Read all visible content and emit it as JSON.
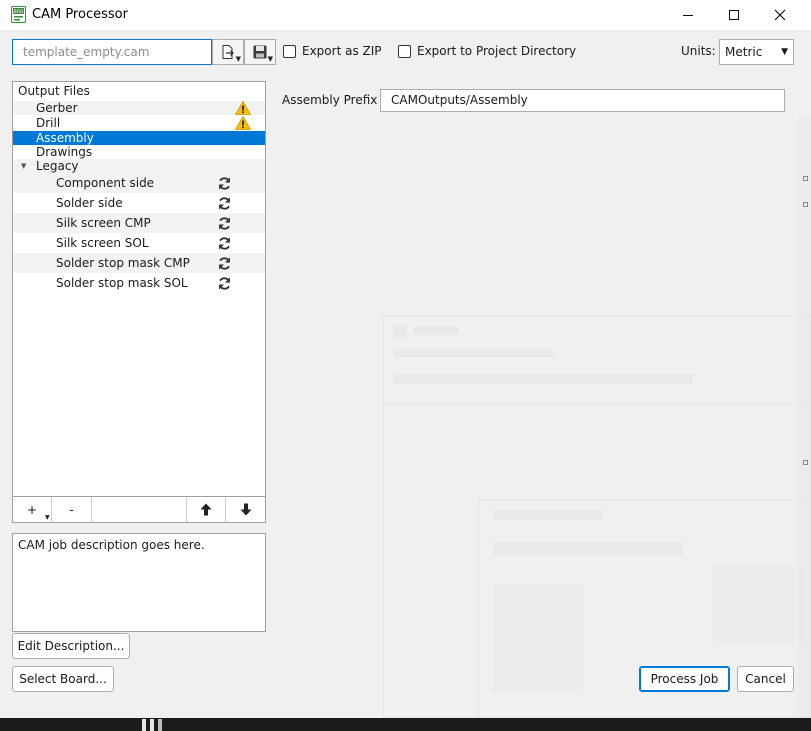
{
  "window": {
    "title": "CAM Processor",
    "app_icon": "eagle-app-icon",
    "controls": [
      "minimize-icon",
      "maximize-icon",
      "close-icon"
    ]
  },
  "toolbar": {
    "file_name": "template_empty.cam",
    "open_icon": "open-file-icon",
    "save_icon": "save-disk-icon",
    "export_zip_label": "Export as ZIP",
    "export_zip_checked": false,
    "export_project_label": "Export to Project Directory",
    "export_project_checked": false,
    "units_label": "Units:",
    "units_value": "Metric"
  },
  "tree": {
    "header": "Output Files",
    "items": [
      {
        "label": "Gerber",
        "icon": "warning-icon",
        "selected": false
      },
      {
        "label": "Drill",
        "icon": "warning-icon",
        "selected": false
      },
      {
        "label": "Assembly",
        "icon": "",
        "selected": true
      },
      {
        "label": "Drawings",
        "icon": "",
        "selected": false
      },
      {
        "label": "Legacy",
        "icon": "",
        "selected": false,
        "expanded": true
      }
    ],
    "legacy_children": [
      {
        "label": "Component side",
        "icon": "refresh-icon"
      },
      {
        "label": "Solder side",
        "icon": "refresh-icon"
      },
      {
        "label": "Silk screen CMP",
        "icon": "refresh-icon"
      },
      {
        "label": "Silk screen SOL",
        "icon": "refresh-icon"
      },
      {
        "label": "Solder stop mask CMP",
        "icon": "refresh-icon"
      },
      {
        "label": "Solder stop mask SOL",
        "icon": "refresh-icon"
      }
    ]
  },
  "list_buttons": {
    "add": "+",
    "remove": "-",
    "up_icon": "arrow-up-icon",
    "down_icon": "arrow-down-icon"
  },
  "description": {
    "text": "CAM job description goes here.",
    "edit_button": "Edit Description..."
  },
  "assembly": {
    "prefix_label": "Assembly Prefix",
    "prefix_value": "CAMOutputs/Assembly"
  },
  "footer": {
    "select_board": "Select Board...",
    "process_job": "Process Job",
    "cancel": "Cancel"
  },
  "colors": {
    "selection": "#0078d7",
    "warning": "#f5c000",
    "window_bg": "#f0f0f0"
  }
}
